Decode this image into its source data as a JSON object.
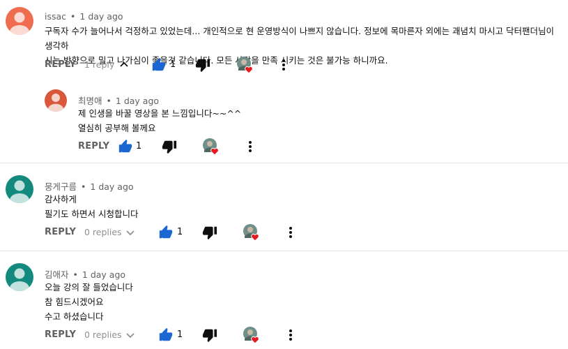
{
  "colors": {
    "avatar_issac": "#ef6c4f",
    "avatar_choi": "#d9573b",
    "avatar_teal": "#138a7d",
    "like_blue": "#1a66d2",
    "heart_red": "#e31b23"
  },
  "comments": [
    {
      "author": "issac",
      "time": "1 day ago",
      "lines": [
        "구독자 수가 늘어나서 걱정하고 있었는데... 개인적으로 현 운영방식이 나쁘지 않습니다. 정보에 목마른자 외에는 괘념치 마시고 닥터팬더님이 생각하",
        "시는 방향으로 밀고 나가심이 좋을것 같습니다. 모든 사람을 만족 시키는 것은 불가능 하니까요."
      ],
      "reply_label": "REPLY",
      "replies_label": "1 reply",
      "likes": "1",
      "icons": [
        "chevron-up-icon",
        "thumbs-up-icon",
        "thumbs-down-icon",
        "creator-heart-icon",
        "more-vert-icon"
      ]
    },
    {
      "author": "최명애",
      "time": "1 day ago",
      "lines": [
        "제 인생을 바꿀 영상을 본 느낌입니다~~^^",
        "열심히 공부해 볼께요"
      ],
      "reply_label": "REPLY",
      "likes": "1"
    },
    {
      "author": "뭉게구름",
      "time": "1 day ago",
      "lines": [
        "감사하게",
        "필기도 하면서 시청합니다"
      ],
      "reply_label": "REPLY",
      "replies_label": "0 replies",
      "likes": "1"
    },
    {
      "author": "김애자",
      "time": "1 day ago",
      "lines": [
        "오늘 강의 잘 들었습니다",
        "참 힘드시겠어요",
        "수고 하셨습니다"
      ],
      "reply_label": "REPLY",
      "replies_label": "0 replies",
      "likes": "1"
    }
  ]
}
